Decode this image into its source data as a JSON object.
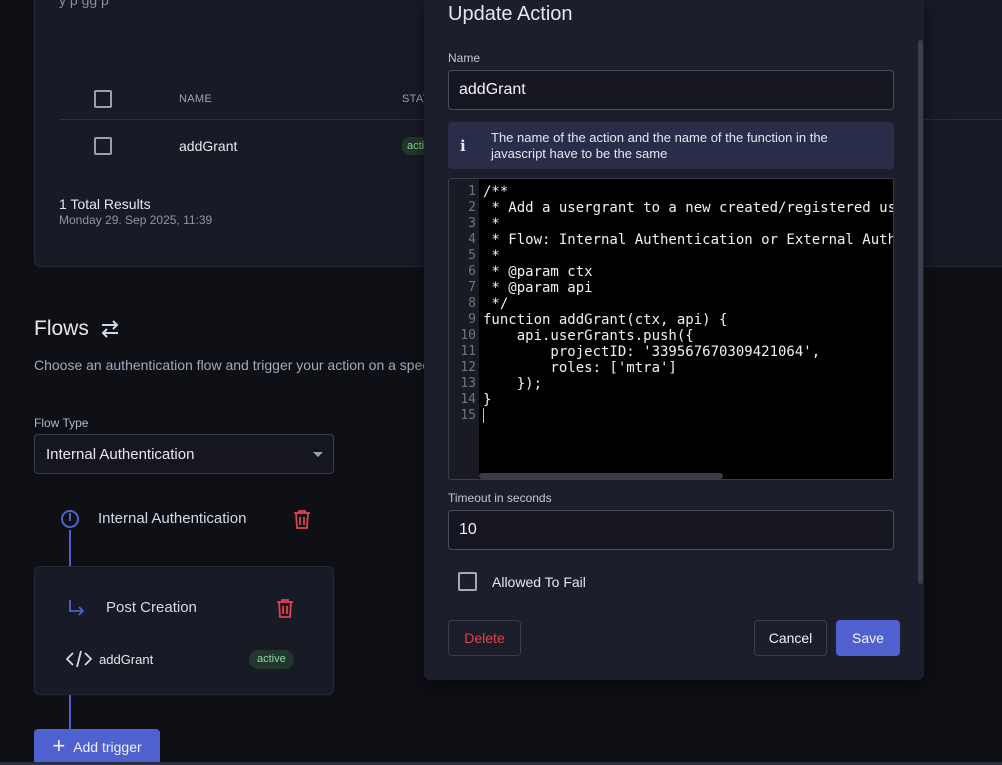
{
  "background": {
    "card": {
      "subtitle_partial": "y            p                              gg          p",
      "table_headers": {
        "name": "NAME",
        "state": "STAT"
      },
      "rows": [
        {
          "name": "addGrant",
          "status_partial": "acti"
        }
      ],
      "total": "1 Total Results",
      "timestamp": "Monday 29. Sep 2025, 11:39"
    },
    "flows": {
      "title": "Flows",
      "description": "Choose an authentication flow and trigger your action on a speci",
      "flow_type_label": "Flow Type",
      "flow_type_value": "Internal Authentication",
      "node_label": "Internal Authentication",
      "trigger_label": "Post Creation",
      "action_name": "addGrant",
      "action_status": "active",
      "add_trigger_label": "Add trigger"
    }
  },
  "dialog": {
    "title": "Update Action",
    "name_label": "Name",
    "name_value": "addGrant",
    "info_text": "The name of the action and the name of the function in the javascript have to be the same",
    "code_lines": [
      "/**",
      " * Add a usergrant to a new created/registered us",
      " *",
      " * Flow: Internal Authentication or External Auth",
      " *",
      " * @param ctx",
      " * @param api",
      " */",
      "function addGrant(ctx, api) {",
      "    api.userGrants.push({",
      "        projectID: '339567670309421064',",
      "        roles: ['mtra']",
      "    });",
      "}",
      ""
    ],
    "timeout_label": "Timeout in seconds",
    "timeout_value": "10",
    "allowed_to_fail_label": "Allowed To Fail",
    "delete_label": "Delete",
    "cancel_label": "Cancel",
    "save_label": "Save"
  },
  "colors": {
    "accent": "#4f61cf",
    "danger": "#e0424f",
    "active_green": "#89d7a4"
  }
}
